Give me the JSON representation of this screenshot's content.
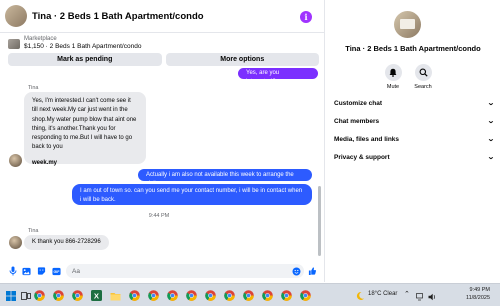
{
  "chat": {
    "title": "Tina · 2 Beds 1 Bath Apartment/condo",
    "listing": {
      "source": "Marketplace",
      "description": "$1,150 · 2 Beds 1 Bath Apartment/condo"
    },
    "actions": {
      "mark_pending": "Mark as pending",
      "more_options": "More options"
    },
    "messages": {
      "out_top": "Yes, are you interested?",
      "sender1": "Tina",
      "in1": "Yes, I'm interested.I can't come see it till next week.My car just went in the shop.My water pump blow that aint one thing, it's another.Thank you for responding to me.But I will have to go back to you",
      "in1_extra": "week.my",
      "out1": "Actually i am also not available this week to arrange the visit.",
      "out2": "I am out of town so. can you send me your contact number, i will be in contact when i will be back.",
      "timestamp": "9:44 PM",
      "sender2": "Tina",
      "in2": "K thank you 866-2728296"
    },
    "composer": {
      "placeholder": "Aa"
    },
    "colors": {
      "outgoing_purple": "#7b2fff",
      "outgoing_blue": "#2d5bff",
      "incoming": "#e9eaed",
      "accent": "#a033ff"
    }
  },
  "details": {
    "title": "Tina · 2 Beds 1 Bath Apartment/condo",
    "actions": [
      {
        "label": "Mute",
        "icon": "bell-icon"
      },
      {
        "label": "Search",
        "icon": "search-icon"
      }
    ],
    "sections": [
      {
        "label": "Customize chat"
      },
      {
        "label": "Chat members"
      },
      {
        "label": "Media, files and links"
      },
      {
        "label": "Privacy & support"
      }
    ]
  },
  "taskbar": {
    "weather": "18°C  Clear",
    "time": "9:49 PM",
    "date": "11/8/2025",
    "apps": [
      "windows-icon",
      "taskview-icon",
      "chrome-icon",
      "chrome-icon",
      "chrome-icon",
      "excel-icon",
      "file-explorer-icon",
      "chrome-icon",
      "chrome-icon",
      "chrome-icon",
      "chrome-icon",
      "chrome-icon",
      "chrome-icon",
      "chrome-icon",
      "chrome-icon",
      "chrome-icon"
    ]
  }
}
